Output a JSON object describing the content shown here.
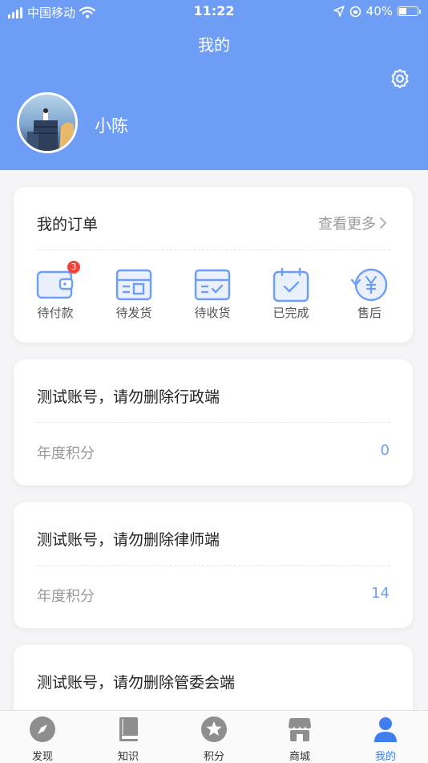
{
  "status_bar": {
    "carrier": "中国移动",
    "time": "11:22",
    "battery": "40%"
  },
  "header": {
    "title": "我的",
    "username": "小陈"
  },
  "orders": {
    "title": "我的订单",
    "more": "查看更多",
    "items": [
      {
        "label": "待付款",
        "badge": "3",
        "icon": "wallet-icon"
      },
      {
        "label": "待发货",
        "icon": "box-icon"
      },
      {
        "label": "待收货",
        "icon": "box-check-icon"
      },
      {
        "label": "已完成",
        "icon": "calendar-check-icon"
      },
      {
        "label": "售后",
        "icon": "refund-yen-icon"
      }
    ]
  },
  "accounts": [
    {
      "title": "测试账号，请勿删除行政端",
      "label": "年度积分",
      "value": "0"
    },
    {
      "title": "测试账号，请勿删除律师端",
      "label": "年度积分",
      "value": "14"
    },
    {
      "title": "测试账号，请勿删除管委会端"
    }
  ],
  "tabs": [
    {
      "label": "发现",
      "icon": "compass-icon"
    },
    {
      "label": "知识",
      "icon": "book-icon"
    },
    {
      "label": "积分",
      "icon": "star-icon"
    },
    {
      "label": "商城",
      "icon": "store-icon"
    },
    {
      "label": "我的",
      "icon": "person-icon",
      "active": true
    }
  ],
  "colors": {
    "primary": "#6e9df5",
    "active_tab": "#3f7ef0",
    "badge": "#f0443a"
  }
}
